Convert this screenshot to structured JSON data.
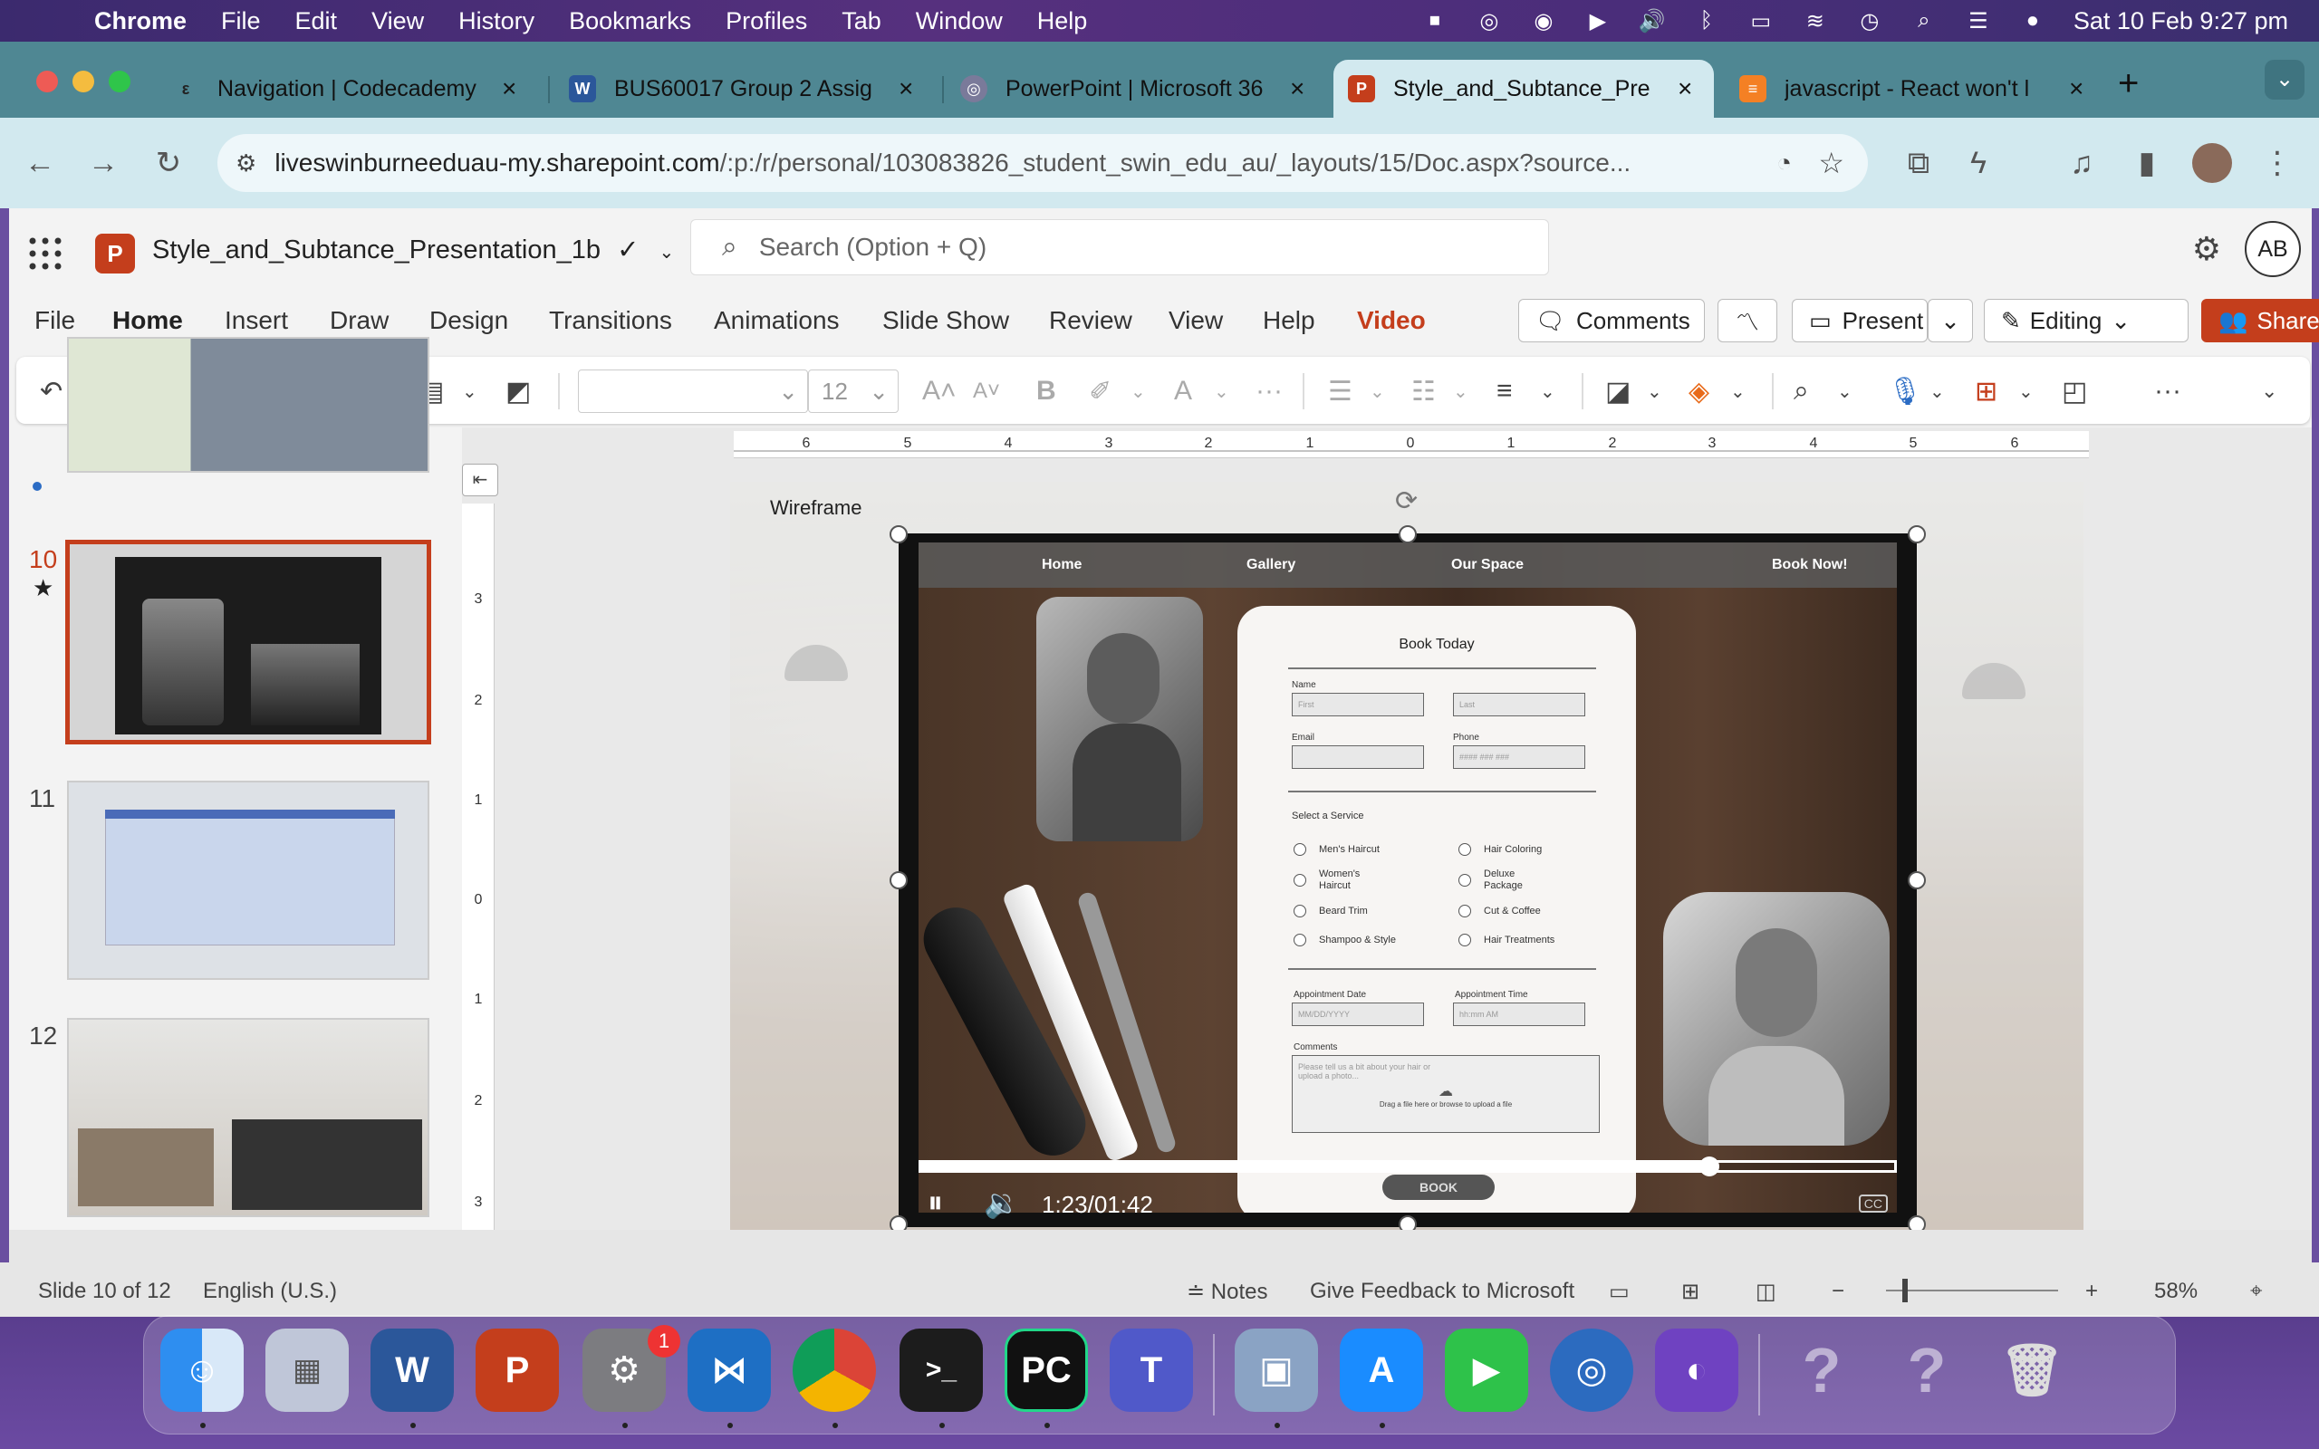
{
  "menubar": {
    "app": "Chrome",
    "items": [
      "File",
      "Edit",
      "View",
      "History",
      "Bookmarks",
      "Profiles",
      "Tab",
      "Window",
      "Help"
    ],
    "datetime": "Sat 10 Feb  9:27 pm"
  },
  "tabs": [
    {
      "title": "Navigation | Codecademy",
      "icon": "codecademy-icon"
    },
    {
      "title": "BUS60017 Group 2 Assig",
      "icon": "word-icon"
    },
    {
      "title": "PowerPoint | Microsoft 36",
      "icon": "office-icon"
    },
    {
      "title": "Style_and_Subtance_Pre",
      "icon": "powerpoint-icon"
    },
    {
      "title": "javascript - React won't l",
      "icon": "stackoverflow-icon"
    }
  ],
  "address": {
    "host": "liveswinburneeduau-my.sharepoint.com",
    "path": "/:p:/r/personal/103083826_student_swin_edu_au/_layouts/15/Doc.aspx?source..."
  },
  "office": {
    "doc_title": "Style_and_Subtance_Presentation_1b",
    "search_placeholder": "Search (Option + Q)",
    "avatar_initials": "AB"
  },
  "ribbon": {
    "tabs": [
      "File",
      "Home",
      "Insert",
      "Draw",
      "Design",
      "Transitions",
      "Animations",
      "Slide Show",
      "Review",
      "View",
      "Help",
      "Video"
    ],
    "comments_label": "Comments",
    "present_label": "Present",
    "editing_label": "Editing",
    "share_label": "Share",
    "font_size": "12"
  },
  "thumbnails": [
    {
      "number": "10"
    },
    {
      "number": "11"
    },
    {
      "number": "12"
    }
  ],
  "slide": {
    "label": "Wireframe",
    "video": {
      "nav": [
        "Home",
        "Gallery",
        "Our Space",
        "Book Now!"
      ],
      "form_title": "Book Today",
      "name_label": "Name",
      "first_ph": "First",
      "last_ph": "Last",
      "email_label": "Email",
      "phone_label": "Phone",
      "phone_ph": "#### ### ###",
      "service_heading": "Select a Service",
      "services": [
        "Men's Haircut",
        "Hair Coloring",
        "Women's Haircut",
        "Deluxe Package",
        "Beard Trim",
        "Cut & Coffee",
        "Shampoo & Style",
        "Hair Treatments"
      ],
      "date_label": "Appointment Date",
      "date_ph": "MM/DD/YYYY",
      "time_label": "Appointment Time",
      "time_ph": "hh:mm  AM",
      "comments_label": "Comments",
      "comments_ph": "Please tell us a bit about your hair or upload a photo...",
      "upload_text": "Drag a file here or browse to upload a file",
      "book_label": "BOOK",
      "timecode": "1:23/01:42",
      "cc": "CC",
      "progress": 0.81
    }
  },
  "status": {
    "slide_count": "Slide 10 of 12",
    "language": "English (U.S.)",
    "notes": "Notes",
    "feedback": "Give Feedback to Microsoft",
    "zoom": "58%"
  },
  "dock": {
    "apps": [
      "Finder",
      "Launchpad",
      "Word",
      "PowerPoint",
      "System Settings",
      "VS Code",
      "Chrome",
      "Terminal",
      "PyCharm",
      "Teams",
      "Preview",
      "App Store",
      "FaceTime",
      "Safari Tool",
      "GitHub",
      "Unknown",
      "Unknown",
      "Trash"
    ],
    "badge": "1"
  }
}
